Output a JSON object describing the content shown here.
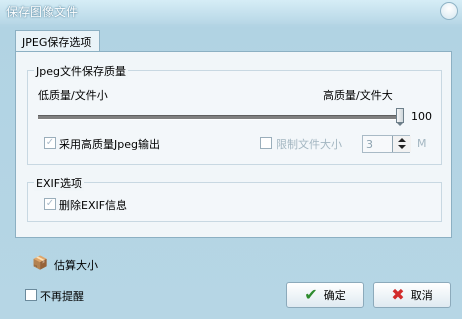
{
  "window": {
    "title": "保存图像文件"
  },
  "tab": {
    "label": "JPEG保存选项"
  },
  "quality_group": {
    "title": "Jpeg文件保存质量",
    "low_label": "低质量/文件小",
    "high_label": "高质量/文件大",
    "slider_value": "100",
    "slider_fraction": 1.0,
    "high_quality_output": {
      "label": "采用高质量Jpeg输出",
      "checked": true,
      "enabled": false
    },
    "limit_size": {
      "label": "限制文件大小",
      "checked": false,
      "enabled": false,
      "value": "3",
      "unit": "M"
    }
  },
  "exif_group": {
    "title": "EXIF选项",
    "delete_exif": {
      "label": "删除EXIF信息",
      "checked": true,
      "enabled": false
    }
  },
  "estimate": {
    "label": "估算大小",
    "icon": "box-icon"
  },
  "no_remind": {
    "label": "不再提醒",
    "checked": false
  },
  "buttons": {
    "ok": {
      "label": "确定",
      "icon": "check-icon",
      "color": "#2e8b2e"
    },
    "cancel": {
      "label": "取消",
      "icon": "x-icon",
      "color": "#d22b2b"
    }
  }
}
